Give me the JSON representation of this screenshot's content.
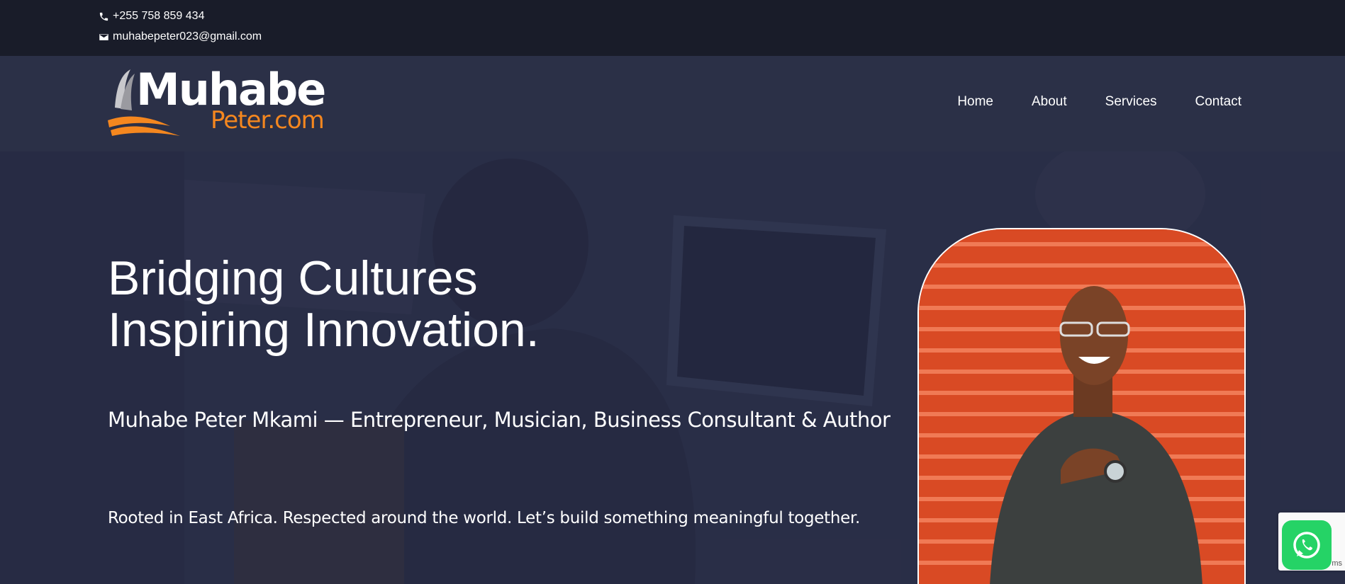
{
  "topbar": {
    "phone": "+255 758 859 434",
    "email": "muhabepeter023@gmail.com",
    "phone_icon": "phone-icon",
    "email_icon": "envelope-icon"
  },
  "logo": {
    "line1": "Muhabe",
    "line2": "Peter.com",
    "brand_color": "#f5871f"
  },
  "nav": {
    "items": [
      {
        "label": "Home"
      },
      {
        "label": "About"
      },
      {
        "label": "Services"
      },
      {
        "label": "Contact"
      }
    ]
  },
  "hero": {
    "headline_line1": "Bridging Cultures",
    "headline_line2": "Inspiring Innovation.",
    "subtitle": "Muhabe Peter Mkami — Entrepreneur, Musician, Business Consultant & Author",
    "tagline": "Rooted in East Africa. Respected around the world. Let’s build something meaningful together."
  },
  "widgets": {
    "recaptcha_text": "ms",
    "whatsapp_icon": "whatsapp-icon"
  },
  "colors": {
    "topbar_bg": "#191c29",
    "header_bg": "#2b3047",
    "portrait_bg": "#d94a24",
    "whatsapp": "#25d366"
  }
}
